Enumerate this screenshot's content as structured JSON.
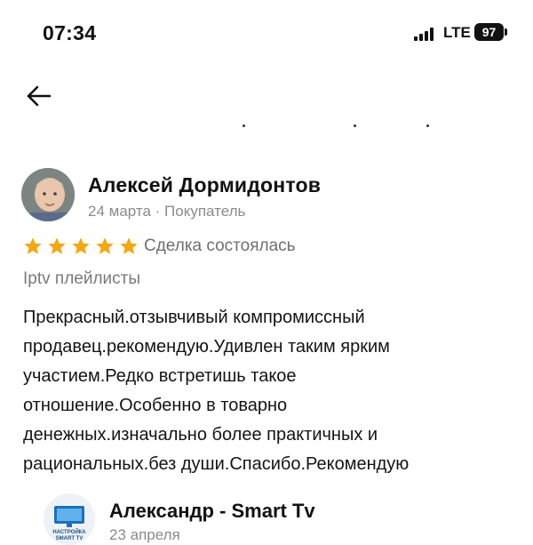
{
  "status_bar": {
    "time": "07:34",
    "network": "LTE",
    "battery": "97",
    "icons": [
      "signal-bars-icon",
      "battery-icon"
    ]
  },
  "nav": {
    "back_icon": "arrow-left-icon"
  },
  "review": {
    "author": "Алексей Дормидонтов",
    "date": "24 марта",
    "separator": "·",
    "role": "Покупатель",
    "rating": 5,
    "star_color": "#F0A818",
    "deal_status": "Сделка состоялась",
    "product": "Iptv плейлисты",
    "text_lines": [
      "Прекрасный.отзывчивый компромиссный",
      "продавец.рекомендую.Удивлен таким ярким",
      "участием.Редко встретишь такое",
      "отношение.Особенно в товарно",
      "денежных.изначально более практичных и",
      "рациональных.без души.Спасибо.Рекомендую"
    ]
  },
  "seller_reply": {
    "name": "Александр - Smart Tv",
    "date": "23 апреля",
    "logo_text": [
      "НАСТРОЙКА",
      "SMART TV"
    ]
  }
}
